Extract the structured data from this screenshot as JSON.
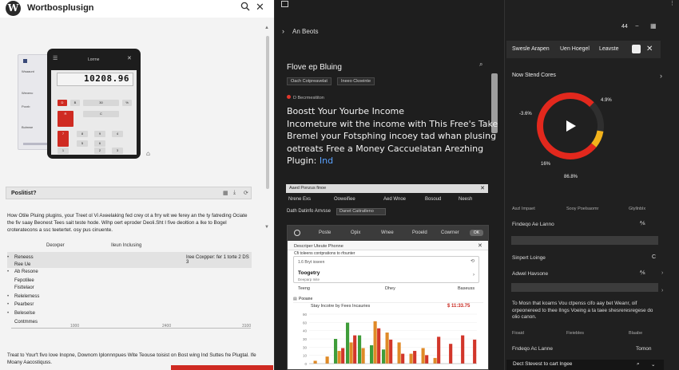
{
  "left": {
    "logo_letter": "W",
    "title": "Wortbosplusign",
    "phone": {
      "title": "Lorrne",
      "display": "10208.96",
      "keys": [
        "D",
        "B",
        "30",
        "%",
        "R",
        "C",
        "7",
        "8",
        "9",
        "4",
        "5",
        "6",
        "1",
        "2",
        "3"
      ],
      "side_labels": [
        "Wsaaunt",
        "Wexenc",
        "Poxrb",
        "Bulmwe"
      ]
    },
    "section_title": "Poslitist?",
    "intro_para": "How Otile Pluing plugins, your Treet ol Vi Axeelaking fed crey ot a frry wit we ferey an the ty fatreding Ociate the fiv saay Beonest Tees sait teste hode. Wihp oert eproder Deoli.Sht I five deoltion a Ike to Bogel croteratecons a ssc teetertet. osy pus cinuente.",
    "col_headers": [
      "Deoxper",
      "Ileun Inclusing"
    ],
    "table_right": "Iree Coxpper: fer 1 torte 2 DS 3",
    "rows": [
      "Reneess",
      "Ree Ue",
      "Ab Resone",
      "Fepotilee",
      "Fisttelaor",
      "Relelemess",
      "Pearbesr",
      "Beleselse",
      "Contmmes"
    ],
    "axis_labels": [
      "1000",
      "2400",
      "3100"
    ],
    "bottom_para": "Treat to Your't fivo love Inopne, Downom Iplonnnpues Wite Teouse toisist on Bost wing Ind Suttes fre Plugtal. Ife Moany Aacostiquss."
  },
  "mid": {
    "nav": "An Beots",
    "subtitle": "Flove ep Bluing",
    "tags": [
      "Oach Cotpreavelat",
      "Ineeo Ckoeinte"
    ],
    "breadcrumb": "D Becrmesititon",
    "headline_lines": [
      "Boostt Your Yourbe Income",
      "Incometure wit the income with This Free's Take",
      "Bremel your Fotsphing incoey tad whan plusing",
      "oetreats Free a Money Caccuelatan Arezhing"
    ],
    "headline_end": "Plugin:",
    "headline_link": "Ind",
    "panel_title": "Aaed Ponzus finoe",
    "col_row": [
      "Nrene Exs",
      "Ooweifiee",
      "Aed Wnoe",
      "Bosoud",
      "Neesh"
    ],
    "filter_label": "Dath Datinfo Arrvsse",
    "filter_value": "Danet Caitratleno",
    "browser": {
      "tabs": [
        "Poste",
        "Opix",
        "Wnee",
        "Pooeld",
        "Cowrner"
      ],
      "pill": "OK",
      "url": "Descriper Uteute Phonne",
      "card_label": "1.6 Bryt ioseen",
      "card_title": "Toogetry",
      "card_sub": "Deeparp Inite",
      "card_heading": "Cfi toleens contprations to rfounter",
      "subtabs": [
        "Teeng",
        "Dhey",
        "Baseuss"
      ],
      "chart_tab": "Pooane"
    }
  },
  "chart_data": {
    "type": "bar",
    "title": "Stay Incotre by Fees Incauries",
    "price_label": "$ 11:33.75",
    "ylim": [
      0,
      70
    ],
    "yticks": [
      "90",
      "60",
      "40",
      "30",
      "30",
      "10",
      "0"
    ],
    "xlabel": "",
    "series": [
      {
        "color": "#3f9d3a",
        "values": [
          0,
          0,
          35,
          58,
          40,
          26,
          20,
          0,
          0,
          0,
          0,
          0,
          0,
          0
        ]
      },
      {
        "color": "#e08a27",
        "values": [
          4,
          10,
          18,
          30,
          22,
          60,
          44,
          30,
          14,
          22,
          8,
          0,
          0,
          0
        ]
      },
      {
        "color": "#d2362a",
        "values": [
          0,
          0,
          22,
          40,
          0,
          50,
          34,
          14,
          18,
          12,
          38,
          28,
          40,
          34
        ]
      }
    ]
  },
  "right": {
    "counter": "44",
    "topbar": [
      "Swesle Arapen",
      "Uen Hoegel",
      "Leavste"
    ],
    "heading": "Now Stend Cores",
    "donut": {
      "red": 76.6,
      "yellow": 8.3,
      "gray": 15.1,
      "labels": [
        "4.9%",
        "-3.6%",
        "16%",
        "86.8%"
      ]
    },
    "col_row": [
      "Aszl Impaet",
      "Sooy Poelsaomr",
      "Gtyllnblx"
    ],
    "items": [
      "Findeqo Ae Lanno",
      "Sinpert Loinge",
      "Adwel Havsone"
    ],
    "para": "To Mosn that koams Vou ctpenss cifo aay bet Weanr, oif orpeonereed to thee lIngs Voeing a ta taee shesreresregese do olio canon.",
    "bottom_labels": [
      "Fioaid",
      "Fieiebles",
      "Blaabe"
    ],
    "footer_item": "Fndeqo Ac Lanne",
    "footer_right": "Tomon",
    "search_row": "Dect Stevest to cart lngee"
  }
}
